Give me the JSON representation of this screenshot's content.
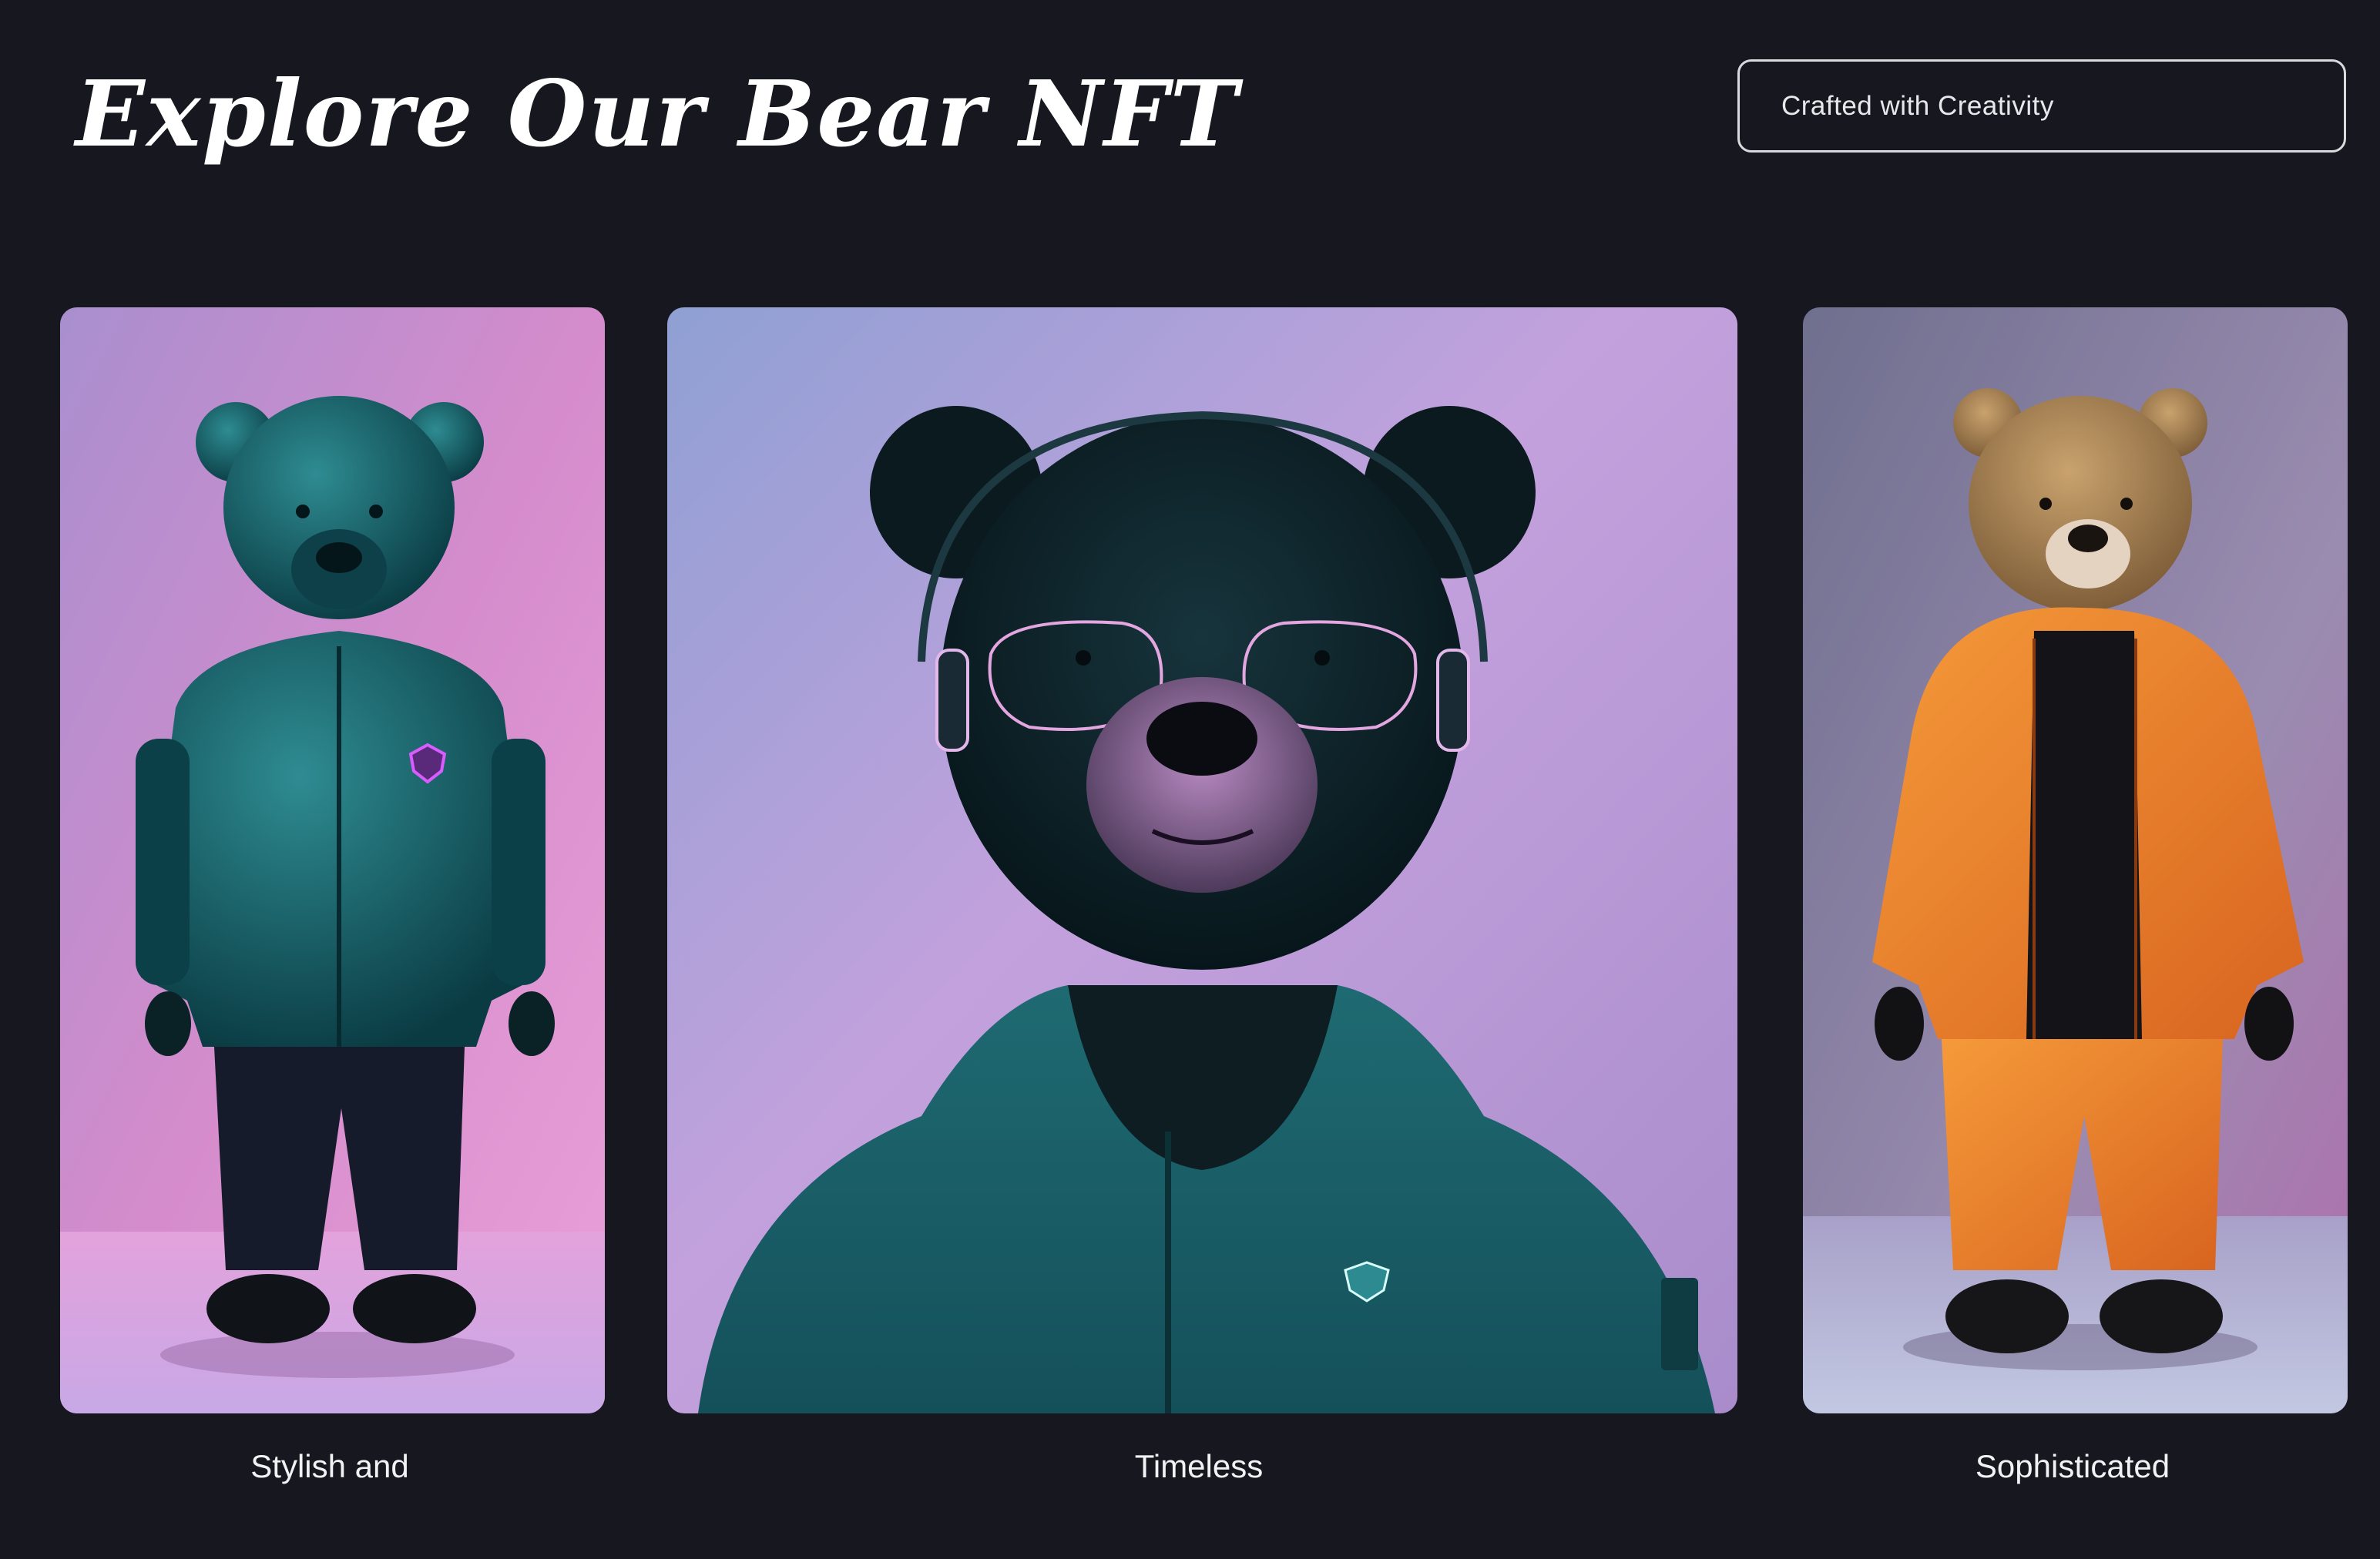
{
  "page": {
    "title": "Explore Our Bear NFT",
    "tagline": "Crafted with Creativity"
  },
  "gallery": {
    "cards": [
      {
        "caption": "Stylish and",
        "image": "teal-leather-bear-full-body",
        "jacket_color": "#0f4a50",
        "bg_color": "#cf86c9"
      },
      {
        "caption": "Timeless",
        "image": "black-bear-headphones-hoodie-portrait",
        "jacket_color": "#1a5c63",
        "bg_color": "#b695cf"
      },
      {
        "caption": "Sophisticated",
        "image": "brown-bear-orange-jacket-full-body",
        "jacket_color": "#e5822a",
        "bg_color": "#8f85a8"
      }
    ]
  },
  "colors": {
    "background": "#17181f",
    "text": "#ffffff",
    "border": "#d9d9de"
  }
}
